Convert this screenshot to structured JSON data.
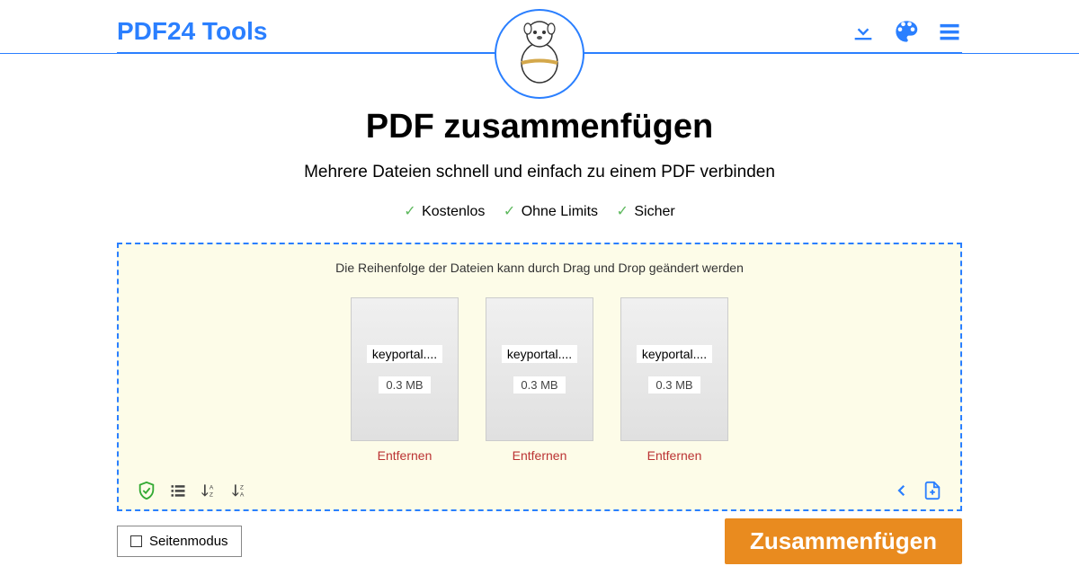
{
  "brand": "PDF24 Tools",
  "heading": "PDF zusammenfügen",
  "subtitle": "Mehrere Dateien schnell und einfach zu einem PDF verbinden",
  "features": [
    "Kostenlos",
    "Ohne Limits",
    "Sicher"
  ],
  "dropzone": {
    "hint": "Die Reihenfolge der Dateien kann durch Drag und Drop geändert werden",
    "remove_label": "Entfernen",
    "files": [
      {
        "name": "keyportal....",
        "size": "0.3 MB"
      },
      {
        "name": "keyportal....",
        "size": "0.3 MB"
      },
      {
        "name": "keyportal....",
        "size": "0.3 MB"
      }
    ]
  },
  "page_mode_label": "Seitenmodus",
  "merge_label": "Zusammenfügen"
}
